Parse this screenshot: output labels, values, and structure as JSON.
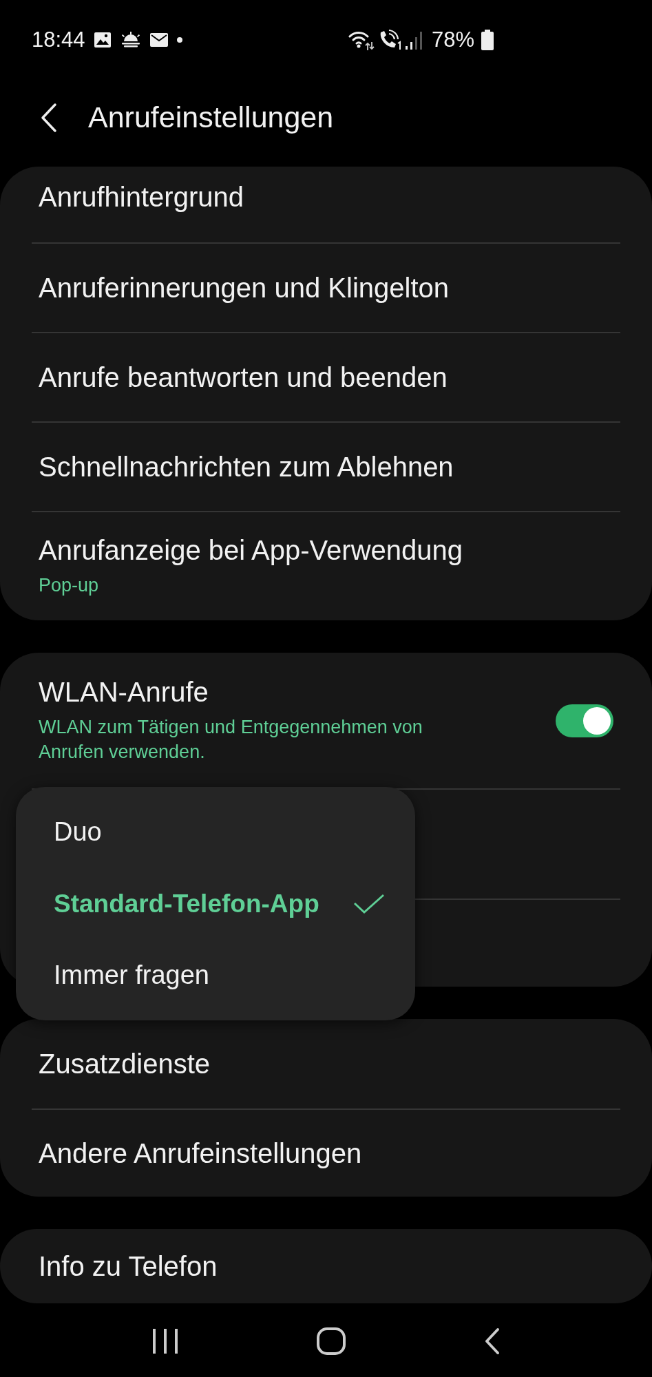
{
  "status_bar": {
    "time": "18:44",
    "battery": "78%"
  },
  "header": {
    "title": "Anrufeinstellungen"
  },
  "groups": [
    {
      "items": [
        {
          "kind": "link",
          "title": "Anrufhintergrund"
        },
        {
          "kind": "link",
          "title": "Anruferinnerungen und Klingelton"
        },
        {
          "kind": "link",
          "title": "Anrufe beantworten und beenden"
        },
        {
          "kind": "link",
          "title": "Schnellnachrichten zum Ablehnen"
        },
        {
          "kind": "link",
          "title": "Anrufanzeige bei App-Verwendung",
          "subtitle": "Pop-up"
        }
      ]
    },
    {
      "items": [
        {
          "kind": "switch",
          "title": "WLAN-Anrufe",
          "subtitle": "WLAN zum Tätigen und Entgegennehmen von Anrufen verwenden.",
          "on": true
        },
        {
          "kind": "covered"
        },
        {
          "kind": "covered"
        }
      ]
    },
    {
      "items": [
        {
          "kind": "link",
          "title": "Zusatzdienste"
        },
        {
          "kind": "link",
          "title": "Andere Anrufeinstellungen"
        }
      ]
    },
    {
      "items": [
        {
          "kind": "link",
          "title": "Info zu Telefon"
        }
      ]
    }
  ],
  "popup": {
    "options": [
      {
        "label": "Duo",
        "selected": false
      },
      {
        "label": "Standard-Telefon-App",
        "selected": true
      },
      {
        "label": "Immer fragen",
        "selected": false
      }
    ]
  }
}
